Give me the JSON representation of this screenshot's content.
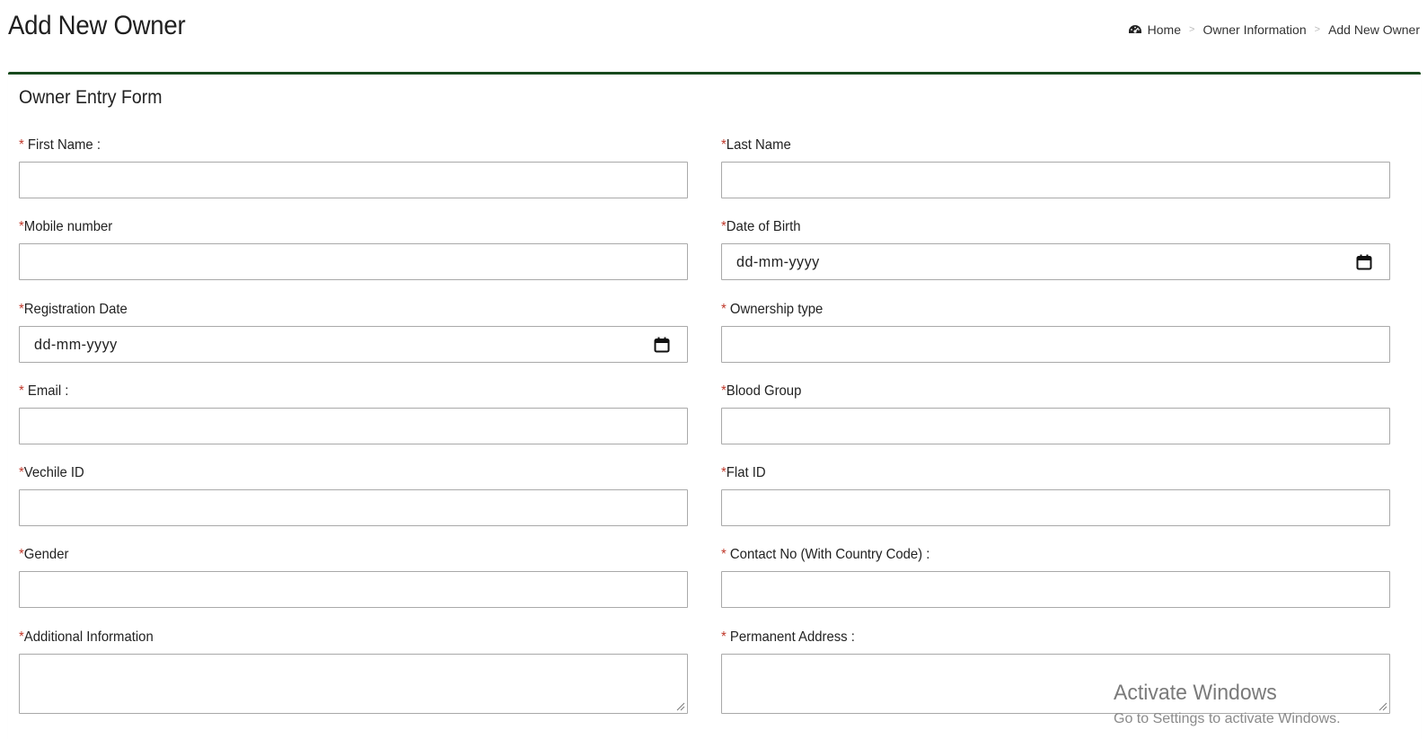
{
  "page": {
    "title": "Add New Owner"
  },
  "breadcrumb": {
    "items": [
      "Home",
      "Owner Information",
      "Add New Owner"
    ],
    "separator": ">"
  },
  "form": {
    "title": "Owner Entry Form",
    "fields": {
      "first_name": {
        "label": " First Name :",
        "required_mark": "*",
        "value": ""
      },
      "last_name": {
        "label": "Last Name",
        "required_mark": "*",
        "value": ""
      },
      "mobile_number": {
        "label": "Mobile number",
        "required_mark": "*",
        "value": ""
      },
      "date_of_birth": {
        "label": "Date of Birth",
        "required_mark": "*",
        "placeholder": "dd-mm-yyyy"
      },
      "registration_date": {
        "label": "Registration Date",
        "required_mark": "*",
        "placeholder": "dd-mm-yyyy"
      },
      "ownership_type": {
        "label": " Ownership type",
        "required_mark": "*",
        "value": ""
      },
      "email": {
        "label": " Email :",
        "required_mark": "*",
        "value": ""
      },
      "blood_group": {
        "label": "Blood Group",
        "required_mark": "*",
        "value": ""
      },
      "vehicle_id": {
        "label": "Vechile ID",
        "required_mark": "*",
        "value": ""
      },
      "flat_id": {
        "label": "Flat ID",
        "required_mark": "*",
        "value": ""
      },
      "gender": {
        "label": "Gender",
        "required_mark": "*",
        "value": ""
      },
      "contact_no": {
        "label": " Contact No (With Country Code) :",
        "required_mark": "*",
        "value": ""
      },
      "additional_info": {
        "label": "Additional Information",
        "required_mark": "*",
        "value": ""
      },
      "permanent_address": {
        "label": " Permanent Address :",
        "required_mark": "*",
        "value": ""
      }
    }
  },
  "watermark": {
    "title": "Activate Windows",
    "subtitle": "Go to Settings to activate Windows."
  },
  "colors": {
    "box_border": "#184a1d",
    "required": "#c0392b",
    "input_border": "#a9a9a9"
  }
}
